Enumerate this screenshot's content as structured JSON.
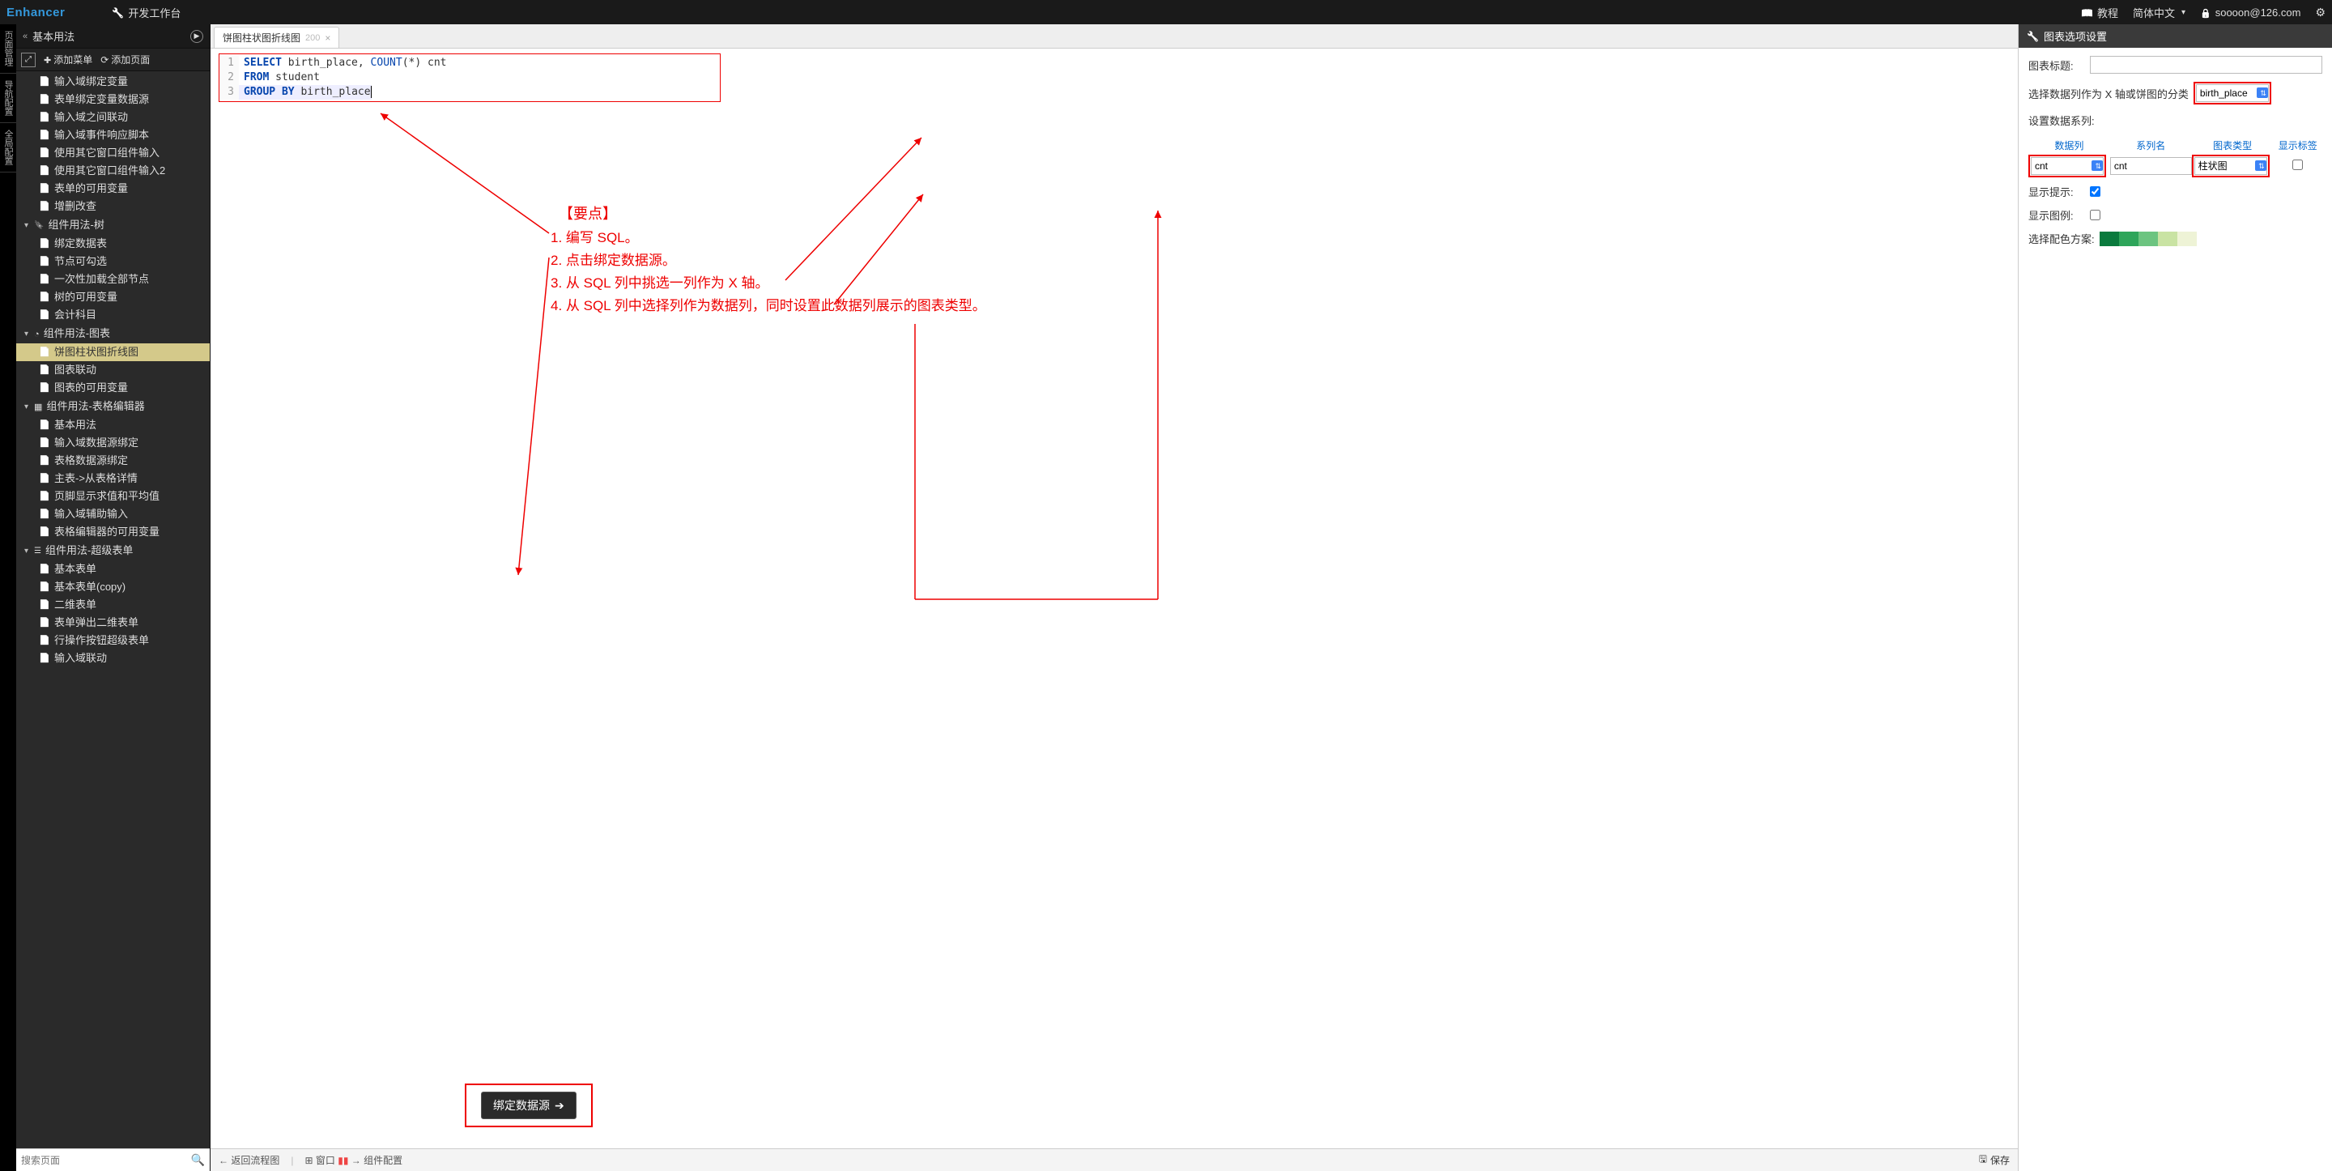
{
  "header": {
    "logo": "Enhancer",
    "workbench": "开发工作台",
    "tutorial": "教程",
    "language": "简体中文",
    "user": "soooon@126.com"
  },
  "vtabs": [
    "页面管理",
    "导航配置",
    "全局配置"
  ],
  "sidebar": {
    "title": "基本用法",
    "add_menu": "添加菜单",
    "add_page": "添加页面",
    "search_placeholder": "搜索页面",
    "groups": [
      {
        "label": "输入域绑定变量"
      },
      {
        "label": "表单绑定变量数据源"
      },
      {
        "label": "输入域之间联动"
      },
      {
        "label": "输入域事件响应脚本"
      },
      {
        "label": "使用其它窗口组件输入"
      },
      {
        "label": "使用其它窗口组件输入2"
      },
      {
        "label": "表单的可用变量"
      },
      {
        "label": "增删改查"
      }
    ],
    "tree_group_label": "组件用法-树",
    "tree_items": [
      "绑定数据表",
      "节点可勾选",
      "一次性加载全部节点",
      "树的可用变量",
      "会计科目"
    ],
    "chart_group_label": "组件用法-图表",
    "chart_items": [
      "饼图柱状图折线图",
      "图表联动",
      "图表的可用变量"
    ],
    "table_group_label": "组件用法-表格编辑器",
    "table_items": [
      "基本用法",
      "输入域数据源绑定",
      "表格数据源绑定",
      "主表->从表格详情",
      "页脚显示求值和平均值",
      "输入域辅助输入",
      "表格编辑器的可用变量"
    ],
    "form_group_label": "组件用法-超级表单",
    "form_items": [
      "基本表单",
      "基本表单(copy)",
      "二维表单",
      "表单弹出二维表单",
      "行操作按钮超级表单",
      "输入域联动"
    ]
  },
  "tabs": {
    "active_label": "饼图柱状图折线图",
    "active_num": "200"
  },
  "code": {
    "l1_kw1": "SELECT",
    "l1_rest": " birth_place, ",
    "l1_fn": "COUNT",
    "l1_rest2": "(*) cnt",
    "l2_kw": "FROM",
    "l2_rest": " student",
    "l3_kw": "GROUP BY",
    "l3_rest": " birth_place"
  },
  "annotations": {
    "title": "【要点】",
    "p1": "1. 编写 SQL。",
    "p2": "2. 点击绑定数据源。",
    "p3": "3. 从 SQL 列中挑选一列作为 X 轴。",
    "p4": "4. 从 SQL 列中选择列作为数据列，同时设置此数据列展示的图表类型。"
  },
  "bind_button": "绑定数据源",
  "bottom": {
    "back": "返回流程图",
    "window": "窗口",
    "config": "组件配置",
    "save": "保存"
  },
  "panel": {
    "title": "图表选项设置",
    "chart_title_label": "图表标题:",
    "chart_title_value": "",
    "xaxis_label": "选择数据列作为 X 轴或饼图的分类",
    "xaxis_value": "birth_place",
    "series_label": "设置数据系列:",
    "col_data": "数据列",
    "col_name": "系列名",
    "col_type": "图表类型",
    "col_show": "显示标签",
    "data_col_value": "cnt",
    "series_name_value": "cnt",
    "chart_type_value": "柱状图",
    "show_tooltip_label": "显示提示:",
    "show_tooltip": true,
    "show_legend_label": "显示图例:",
    "show_legend": false,
    "color_scheme_label": "选择配色方案:",
    "colors": [
      "#0a7a3d",
      "#2ea55a",
      "#6cc480",
      "#c9e3a3",
      "#eef3d6"
    ]
  }
}
